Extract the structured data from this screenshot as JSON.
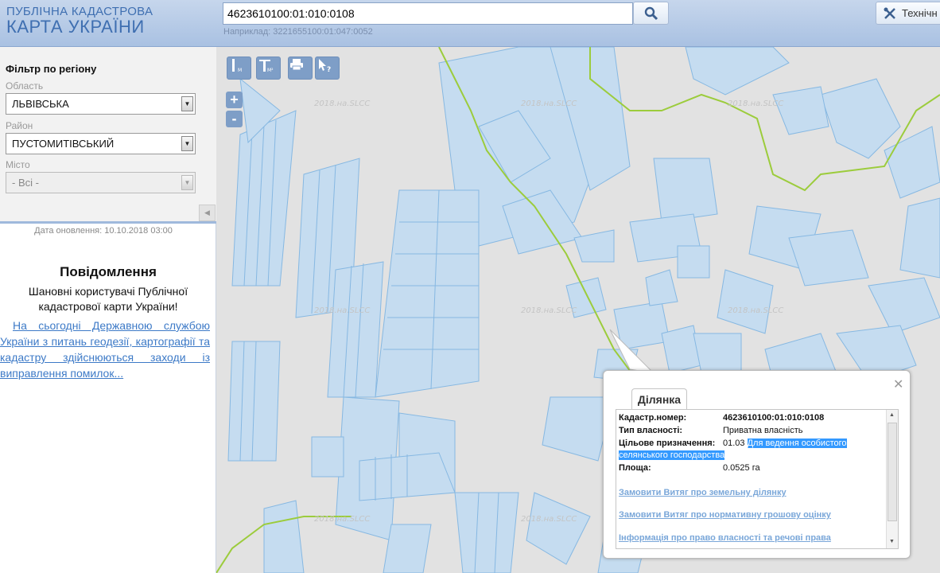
{
  "header": {
    "logo_line1": "ПУБЛІЧНА КАДАСТРОВА",
    "logo_line2": "КАРТА УКРАЇНИ",
    "search_value": "4623610100:01:010:0108",
    "example": "Наприклад: 3221655100:01:047:0052",
    "tech_label": "Технічн"
  },
  "sidebar": {
    "filter_title": "Фільтр по регіону",
    "oblast_label": "Область",
    "oblast_value": "ЛЬВІВСЬКА",
    "rayon_label": "Район",
    "rayon_value": "ПУСТОМИТІВСЬКИЙ",
    "city_label": "Місто",
    "city_value": "- Всі -",
    "updated": "Дата оновлення: 10.10.2018 03:00",
    "notice_title": "Повідомлення",
    "notice_greeting": "Шановні користувачі Публічної кадастрової карти України!",
    "notice_link": "На сьогодні Державною службою України з питань геодезії, картографії та кадастру здійснюються заходи із виправлення помилок..."
  },
  "map": {
    "watermark": "2018.на.SLCC",
    "tools": [
      "ruler-icon",
      "area-ruler-icon",
      "print-icon",
      "identify-icon"
    ],
    "tool_sub": [
      "М",
      "М²"
    ],
    "zoom_in": "+",
    "zoom_out": "-"
  },
  "popup": {
    "tab": "Ділянка",
    "cad_label": "Кадастр.номер:",
    "cad_value": "4623610100:01:010:0108",
    "own_label": "Тип власності:",
    "own_value": "Приватна власність",
    "purpose_label": "Цільове призначення:",
    "purpose_code": "01.03",
    "purpose_text1": "Для ведення особистого",
    "purpose_text2": "селянського господарства",
    "area_label": "Площа:",
    "area_value": "0.0525 га",
    "link1": "Замовити Витяг про земельну ділянку",
    "link2": "Замовити Витяг про нормативну грошову оцінку",
    "link3": "Інформація про право власності та речові права"
  },
  "colors": {
    "parcel_fill": "#c5dcf0",
    "parcel_stroke": "#86b8e2",
    "boundary": "#9ccc3c",
    "map_bg": "#e2e2e2",
    "header_bg": "#b7cce8"
  }
}
